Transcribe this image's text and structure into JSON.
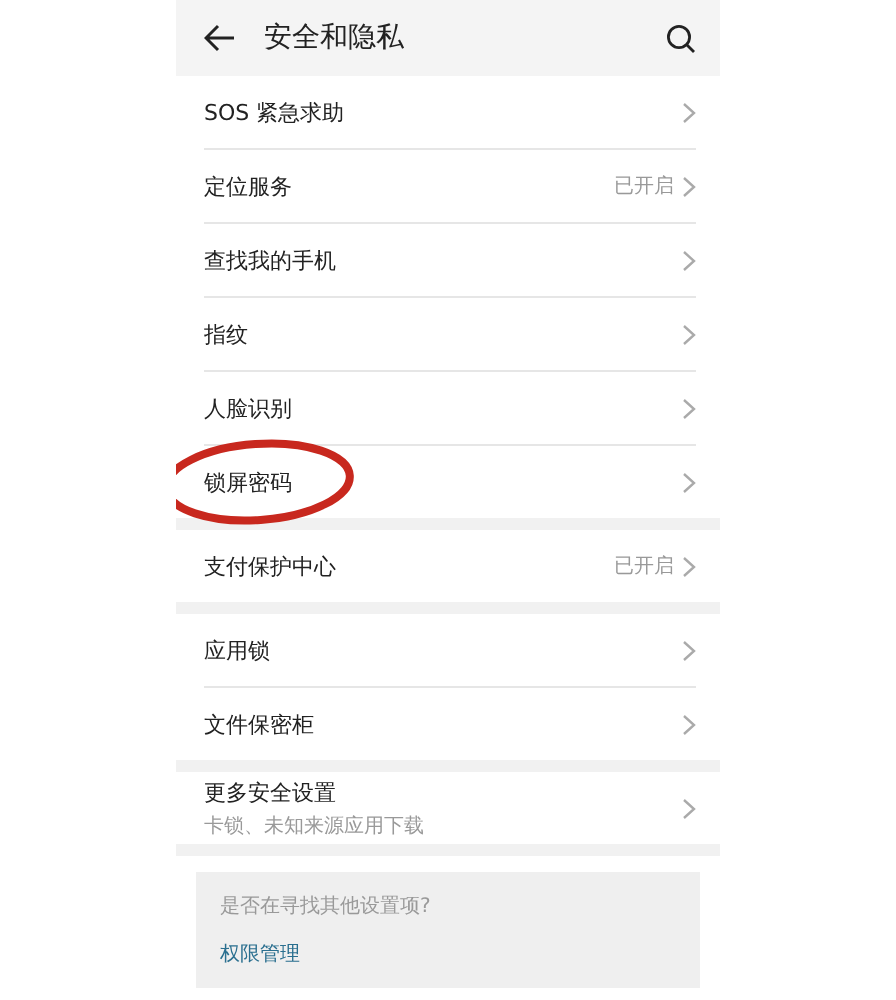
{
  "header": {
    "title": "安全和隐私"
  },
  "groups": [
    {
      "rows": [
        {
          "label": "SOS 紧急求助",
          "circled": false
        },
        {
          "label": "定位服务",
          "status": "已开启",
          "circled": false
        },
        {
          "label": "查找我的手机",
          "circled": false
        },
        {
          "label": "指纹",
          "circled": false
        },
        {
          "label": "人脸识别",
          "circled": false
        },
        {
          "label": "锁屏密码",
          "circled": true
        }
      ]
    },
    {
      "rows": [
        {
          "label": "支付保护中心",
          "status": "已开启",
          "circled": false
        }
      ]
    },
    {
      "rows": [
        {
          "label": "应用锁",
          "circled": false
        },
        {
          "label": "文件保密柜",
          "circled": false
        }
      ]
    },
    {
      "rows": [
        {
          "label": "更多安全设置",
          "subtitle": "卡锁、未知来源应用下载",
          "circled": false
        }
      ]
    }
  ],
  "hint": {
    "question": "是否在寻找其他设置项?",
    "link": "权限管理"
  }
}
